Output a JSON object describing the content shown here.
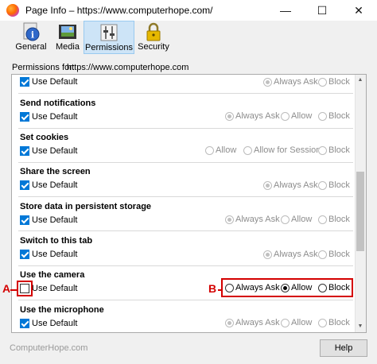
{
  "window": {
    "title": "Page Info – https://www.computerhope.com/",
    "minimize": "—",
    "maximize": "☐",
    "close": "✕"
  },
  "toolbar": {
    "tabs": [
      {
        "label": "General",
        "icon": "info-icon"
      },
      {
        "label": "Media",
        "icon": "media-icon"
      },
      {
        "label": "Permissions",
        "icon": "permissions-icon",
        "selected": true
      },
      {
        "label": "Security",
        "icon": "lock-icon"
      }
    ]
  },
  "permissions_for": {
    "label": "Permissions for:",
    "url": "https://www.computerhope.com"
  },
  "sections": [
    {
      "title": "",
      "use_default": "Use Default",
      "checked": true,
      "options": [
        "Always Ask",
        "Block"
      ],
      "selected": "Always Ask",
      "enabled": false
    },
    {
      "title": "Send notifications",
      "use_default": "Use Default",
      "checked": true,
      "options": [
        "Always Ask",
        "Allow",
        "Block"
      ],
      "selected": "Always Ask",
      "enabled": false
    },
    {
      "title": "Set cookies",
      "use_default": "Use Default",
      "checked": true,
      "options": [
        "Allow",
        "Allow for Session",
        "Block"
      ],
      "selected": "",
      "enabled": false
    },
    {
      "title": "Share the screen",
      "use_default": "Use Default",
      "checked": true,
      "options": [
        "Always Ask",
        "Block"
      ],
      "selected": "Always Ask",
      "enabled": false
    },
    {
      "title": "Store data in persistent storage",
      "use_default": "Use Default",
      "checked": true,
      "options": [
        "Always Ask",
        "Allow",
        "Block"
      ],
      "selected": "Always Ask",
      "enabled": false
    },
    {
      "title": "Switch to this tab",
      "use_default": "Use Default",
      "checked": true,
      "options": [
        "Always Ask",
        "Block"
      ],
      "selected": "Always Ask",
      "enabled": false
    },
    {
      "title": "Use the camera",
      "use_default": "Use Default",
      "checked": false,
      "options": [
        "Always Ask",
        "Allow",
        "Block"
      ],
      "selected": "Allow",
      "enabled": true
    },
    {
      "title": "Use the microphone",
      "use_default": "Use Default",
      "checked": true,
      "options": [
        "Always Ask",
        "Allow",
        "Block"
      ],
      "selected": "Always Ask",
      "enabled": false
    }
  ],
  "annotations": {
    "a": "A",
    "b": "B"
  },
  "footer": {
    "watermark": "ComputerHope.com",
    "help": "Help"
  },
  "colors": {
    "accent": "#0078d7",
    "annotation": "#d40000"
  }
}
